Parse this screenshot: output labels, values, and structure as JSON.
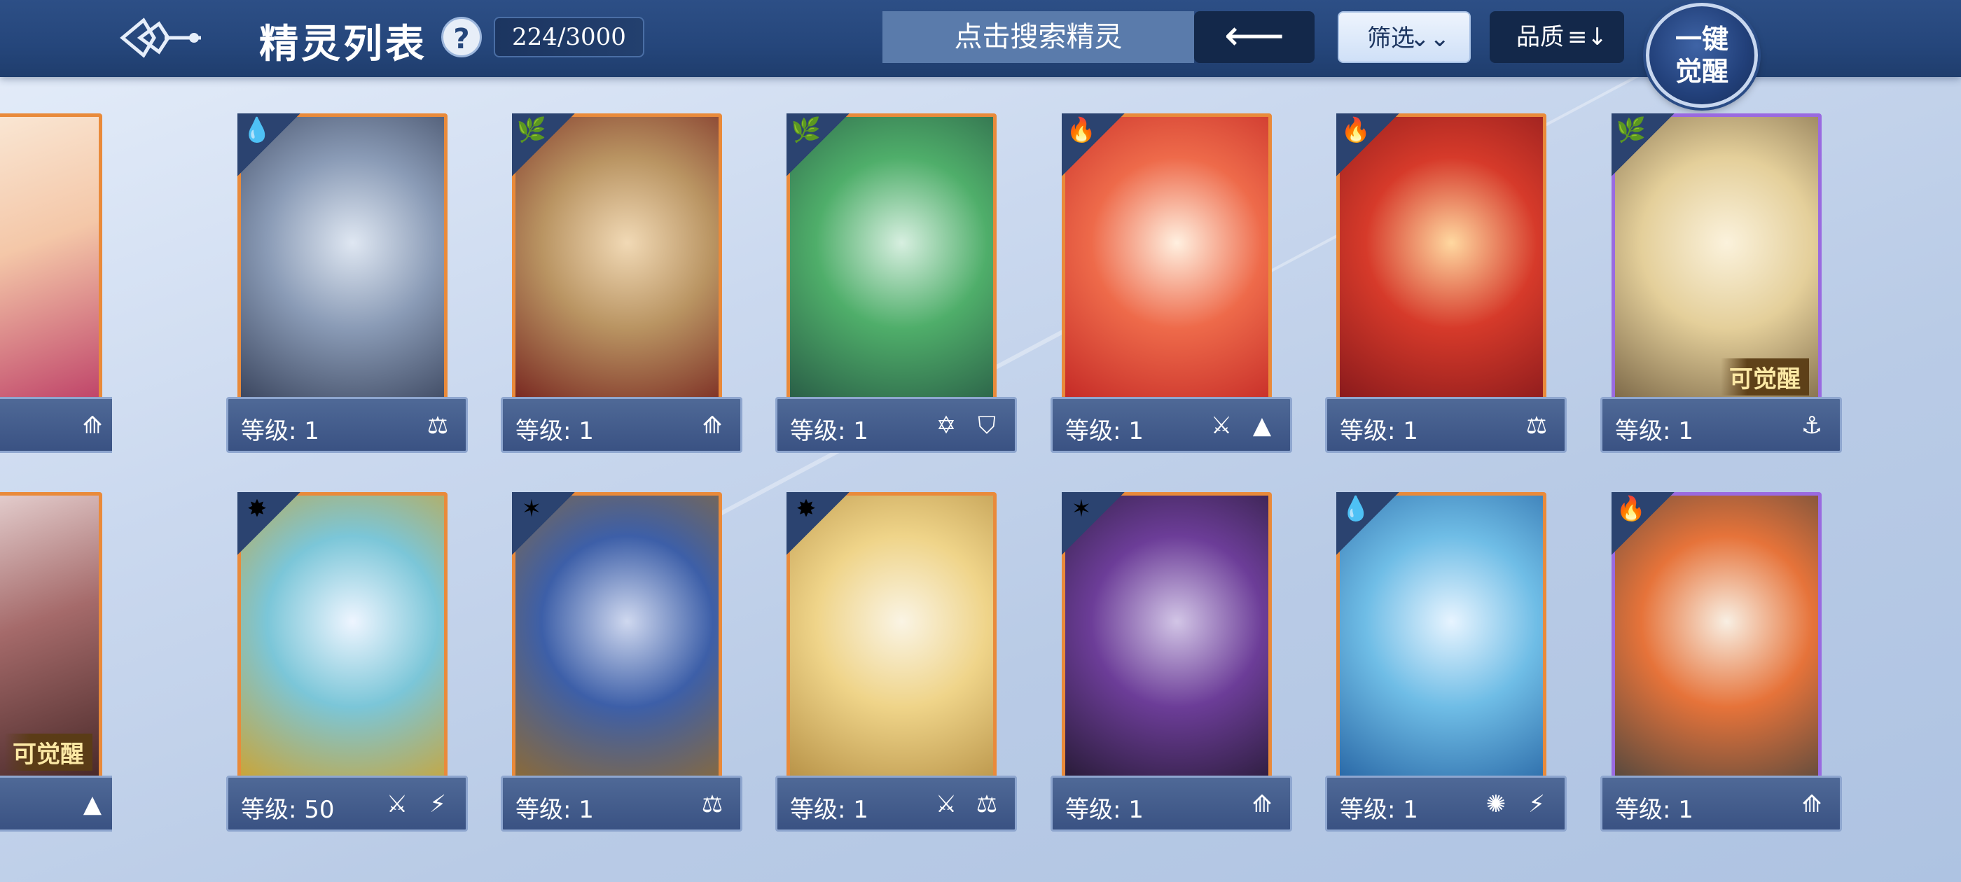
{
  "header": {
    "title": "精灵列表",
    "help_label": "?",
    "count": "224/3000",
    "search_placeholder": "点击搜索精灵",
    "back_label": "⟵",
    "filter_label": "筛选",
    "filter_icon": "⌄⌄",
    "quality_label": "品质",
    "quality_icon": "≡↓",
    "awaken_line1": "一键",
    "awaken_line2": "觉醒"
  },
  "colors": {
    "frame_orange": "#e98a3a",
    "frame_purple": "#9a6ae0",
    "plate": "#3a5283",
    "topbar": "#25467b"
  },
  "cards": [
    {
      "level": "等级: 1",
      "element": "water-icon",
      "element_glyph": "💧",
      "badges": [
        "⚖"
      ],
      "awaken": "",
      "frame": "orange",
      "art": [
        "#dfe7f2",
        "#8a9bb6",
        "#3c4760"
      ]
    },
    {
      "level": "等级: 1",
      "element": "leaf-icon",
      "element_glyph": "🌿",
      "badges": [
        "⟰"
      ],
      "awaken": "",
      "frame": "orange",
      "art": [
        "#f1d9b5",
        "#b99462",
        "#7a2a22"
      ]
    },
    {
      "level": "等级: 1",
      "element": "leaf-icon",
      "element_glyph": "🌿",
      "badges": [
        "✡",
        "⛉"
      ],
      "awaken": "",
      "frame": "orange",
      "art": [
        "#d7efe0",
        "#4fae6a",
        "#2a5f47"
      ]
    },
    {
      "level": "等级: 1",
      "element": "fire-icon",
      "element_glyph": "🔥",
      "badges": [
        "⚔",
        "▲"
      ],
      "awaken": "",
      "frame": "orange",
      "art": [
        "#fff0e0",
        "#ee6a4a",
        "#c52b27"
      ]
    },
    {
      "level": "等级: 1",
      "element": "fire-icon",
      "element_glyph": "🔥",
      "badges": [
        "⚖"
      ],
      "awaken": "",
      "frame": "orange",
      "art": [
        "#ffd8a0",
        "#d63a2a",
        "#8a1a1c"
      ]
    },
    {
      "level": "等级: 1",
      "element": "leaf-icon",
      "element_glyph": "🌿",
      "badges": [
        "⚓"
      ],
      "awaken": "可觉醒",
      "frame": "purple",
      "art": [
        "#fbf2dc",
        "#e4cf9a",
        "#7f6b4a"
      ]
    },
    {
      "level": "等级: 50",
      "element": "sun-icon",
      "element_glyph": "✸",
      "badges": [
        "⚔",
        "⚡"
      ],
      "awaken": "",
      "frame": "orange",
      "art": [
        "#eef5ff",
        "#7bc6d8",
        "#c9a53a"
      ]
    },
    {
      "level": "等级: 1",
      "element": "shadow-icon",
      "element_glyph": "✶",
      "badges": [
        "⚖"
      ],
      "awaken": "",
      "frame": "orange",
      "art": [
        "#cfd8ef",
        "#3d5fa8",
        "#8a6a3a"
      ]
    },
    {
      "level": "等级: 1",
      "element": "sun-icon",
      "element_glyph": "✸",
      "badges": [
        "⚔",
        "⚖"
      ],
      "awaken": "",
      "frame": "orange",
      "art": [
        "#faf4e4",
        "#efd489",
        "#b99449"
      ]
    },
    {
      "level": "等级: 1",
      "element": "shadow-icon",
      "element_glyph": "✶",
      "badges": [
        "⟰"
      ],
      "awaken": "",
      "frame": "orange",
      "art": [
        "#d2c5e6",
        "#6c3d98",
        "#2a1c3a"
      ]
    },
    {
      "level": "等级: 1",
      "element": "water-icon",
      "element_glyph": "💧",
      "badges": [
        "✺",
        "⚡"
      ],
      "awaken": "",
      "frame": "orange",
      "art": [
        "#e7f4ff",
        "#6fbde6",
        "#2b6aa8"
      ]
    },
    {
      "level": "等级: 1",
      "element": "fire-icon",
      "element_glyph": "🔥",
      "badges": [
        "⟰"
      ],
      "awaken": "",
      "frame": "purple",
      "art": [
        "#f8efe3",
        "#e6733a",
        "#5a4a3e"
      ]
    }
  ],
  "partial_cards": [
    {
      "badge": "⟰",
      "awaken": ""
    },
    {
      "badge": "▲",
      "awaken": "可觉醒"
    }
  ]
}
